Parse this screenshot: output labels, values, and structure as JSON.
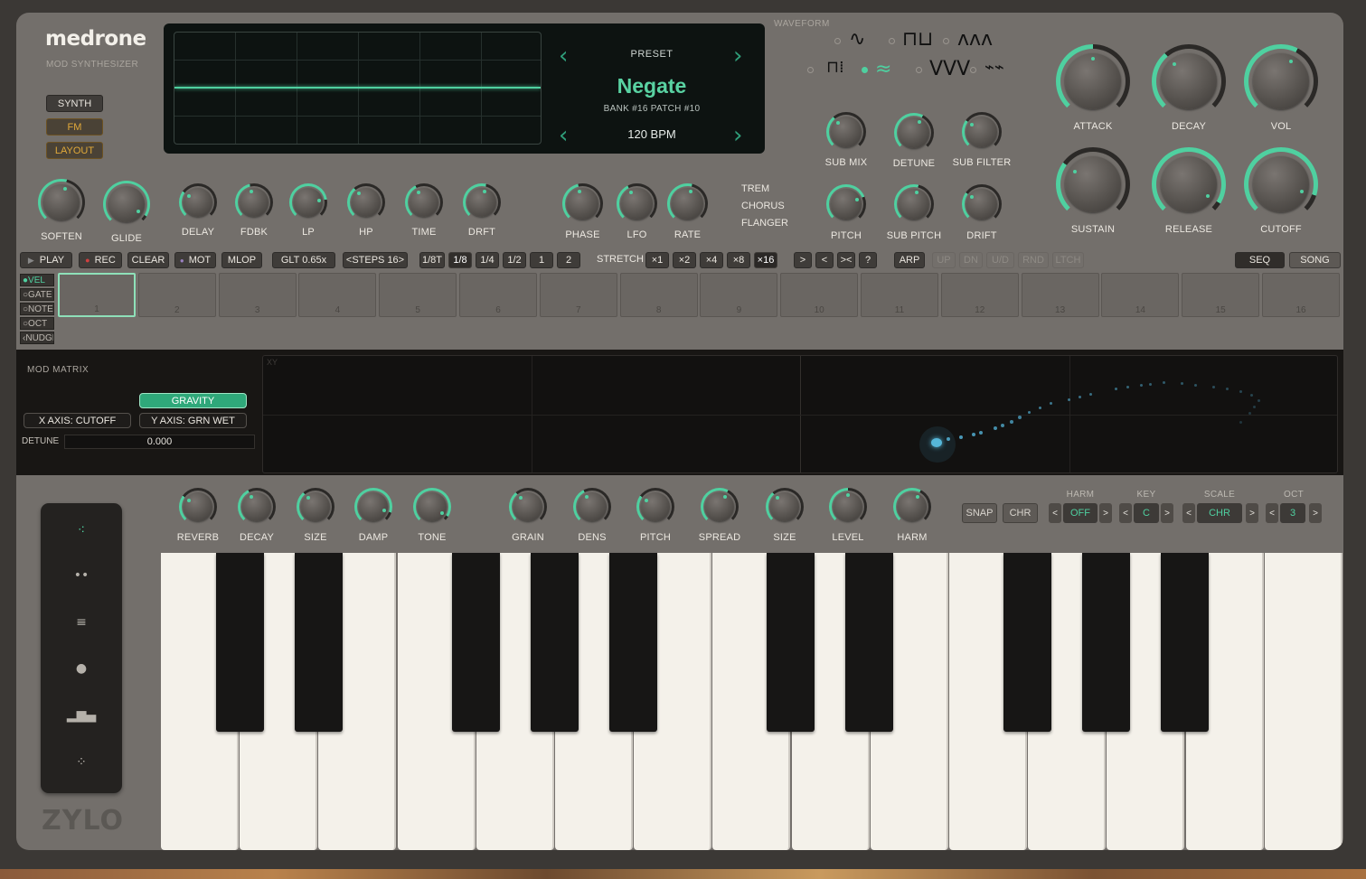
{
  "brand": {
    "name": "medrone",
    "subtitle": "MOD SYNTHESIZER",
    "footer_logo": "ZYLO"
  },
  "modes": [
    "SYNTH",
    "FM",
    "LAYOUT"
  ],
  "preset": {
    "label": "PRESET",
    "name": "Negate",
    "bank": "BANK #16  PATCH #10",
    "bpm": "120 BPM"
  },
  "waveform": {
    "title": "WAVEFORM",
    "selected": "noise-sine"
  },
  "knobs_top_left": [
    {
      "label": "SOFTEN",
      "value": 0.55
    },
    {
      "label": "GLIDE",
      "value": 0.95
    },
    {
      "label": "DELAY",
      "value": 0.3
    },
    {
      "label": "FDBK",
      "value": 0.45
    },
    {
      "label": "LP",
      "value": 0.8
    },
    {
      "label": "HP",
      "value": 0.35
    },
    {
      "label": "TIME",
      "value": 0.4
    },
    {
      "label": "DRFT",
      "value": 0.55
    },
    {
      "label": "PHASE",
      "value": 0.45
    },
    {
      "label": "LFO",
      "value": 0.4
    },
    {
      "label": "RATE",
      "value": 0.55
    }
  ],
  "fx_list": [
    "TREM",
    "CHORUS",
    "FLANGER"
  ],
  "knobs_mid": [
    {
      "label": "SUB MIX",
      "value": 0.35
    },
    {
      "label": "DETUNE",
      "value": 0.6
    },
    {
      "label": "SUB FILTER",
      "value": 0.3
    },
    {
      "label": "PITCH",
      "value": 0.75
    },
    {
      "label": "SUB PITCH",
      "value": 0.55
    },
    {
      "label": "DRIFT",
      "value": 0.3
    }
  ],
  "knobs_env": [
    {
      "label": "ATTACK",
      "value": 0.5
    },
    {
      "label": "DECAY",
      "value": 0.35
    },
    {
      "label": "VOL",
      "value": 0.6
    },
    {
      "label": "SUSTAIN",
      "value": 0.3
    },
    {
      "label": "RELEASE",
      "value": 0.95
    },
    {
      "label": "CUTOFF",
      "value": 0.9
    }
  ],
  "transport": {
    "play": "PLAY",
    "rec": "REC",
    "clear": "CLEAR",
    "mot": "MOT",
    "mlop": "MLOP",
    "glt": "GLT 0.65x",
    "steps": "<STEPS 16>",
    "divisions": [
      "1/8T",
      "1/8",
      "1/4",
      "1/2",
      "1",
      "2"
    ],
    "division_selected": "1/8",
    "stretch_label": "STRETCH",
    "stretch": [
      "×1",
      "×2",
      "×4",
      "×8",
      "×16"
    ],
    "stretch_selected": "×16",
    "dirs": [
      ">",
      "<",
      "><",
      "?"
    ],
    "arp": "ARP",
    "arp_modes": [
      "UP",
      "DN",
      "U/D",
      "RND",
      "LTCH"
    ],
    "seq": "SEQ",
    "song": "SONG"
  },
  "lanes": [
    "VEL",
    "GATE",
    "NOTE",
    "OCT",
    "NUDGE"
  ],
  "lane_selected": "VEL",
  "steps": [
    "1",
    "2",
    "3",
    "4",
    "5",
    "6",
    "7",
    "8",
    "9",
    "10",
    "11",
    "12",
    "13",
    "14",
    "15",
    "16"
  ],
  "current_step": "1",
  "mod_matrix": {
    "title": "MOD MATRIX",
    "gravity": "GRAVITY",
    "x_axis": "X AXIS: CUTOFF",
    "y_axis": "Y AXIS: GRN WET",
    "detune_label": "DETUNE",
    "detune_value": "0.000",
    "xy_label": "XY"
  },
  "knobs_fx": [
    {
      "label": "REVERB",
      "value": 0.3
    },
    {
      "label": "DECAY",
      "value": 0.4
    },
    {
      "label": "SIZE",
      "value": 0.35
    },
    {
      "label": "DAMP",
      "value": 0.9
    },
    {
      "label": "TONE",
      "value": 0.95
    }
  ],
  "knobs_grain": [
    {
      "label": "GRAIN",
      "value": 0.35
    },
    {
      "label": "DENS",
      "value": 0.4
    },
    {
      "label": "PITCH",
      "value": 0.3
    },
    {
      "label": "SPREAD",
      "value": 0.6
    },
    {
      "label": "SIZE",
      "value": 0.35
    },
    {
      "label": "LEVEL",
      "value": 0.5
    },
    {
      "label": "HARM",
      "value": 0.6
    }
  ],
  "scale": {
    "snap": "SNAP",
    "chr": "CHR",
    "harm_label": "HARM",
    "harm_value": "OFF",
    "key_label": "KEY",
    "key_value": "C",
    "scale_label": "SCALE",
    "scale_value": "CHR",
    "oct_label": "OCT",
    "oct_value": "3",
    "prev": "<",
    "next": ">"
  },
  "colors": {
    "accent": "#4fd0a0",
    "panel": "#736f6b",
    "screen": "#0d1311"
  }
}
